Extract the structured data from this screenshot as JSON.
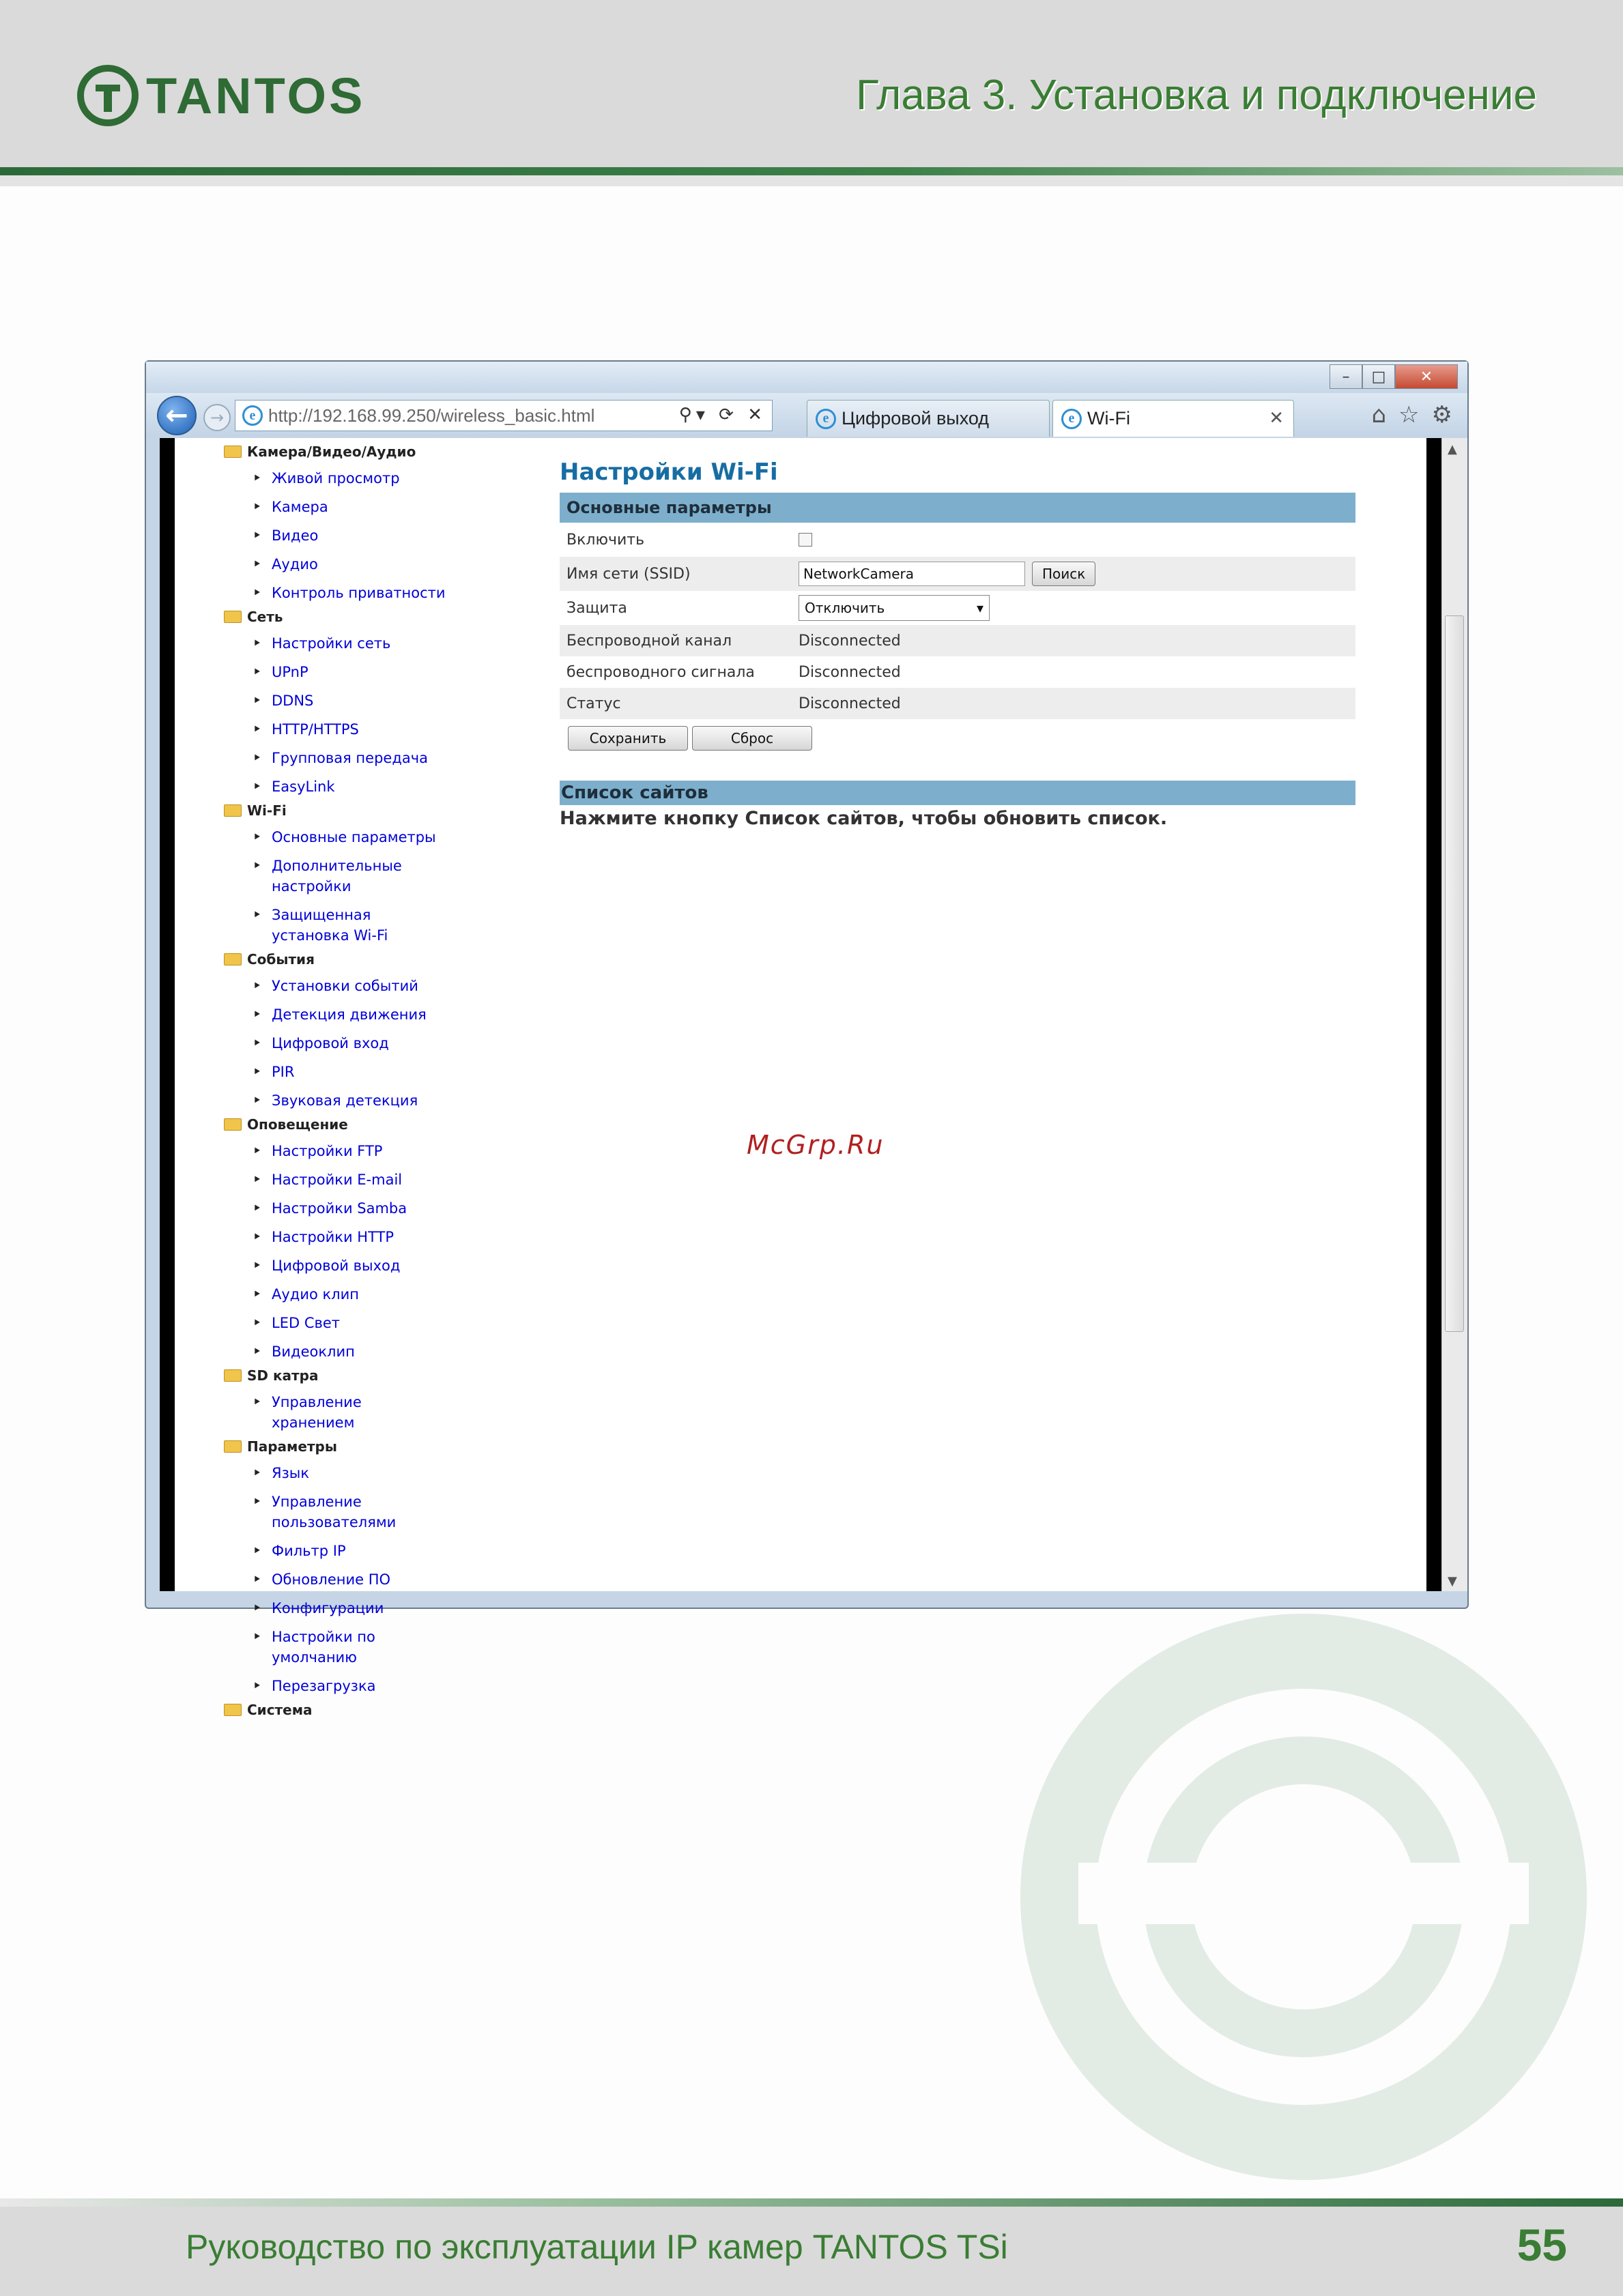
{
  "header": {
    "logo_text": "TANTOS",
    "chapter": "Глава 3. Установка и подключение"
  },
  "footer": {
    "title": "Руководство по эксплуатации IP камер TANTOS TSi",
    "page_number": "55"
  },
  "browser": {
    "url": "http://192.168.99.250/wireless_basic.html",
    "tabs": [
      {
        "label": "Цифровой выход"
      },
      {
        "label": "Wi-Fi"
      }
    ],
    "window_controls": {
      "minimize": "–",
      "maximize": "□",
      "close": "✕"
    }
  },
  "sidebar": [
    {
      "label": "Камера/Видео/Аудио",
      "items": [
        "Живой просмотр",
        "Камера",
        "Видео",
        "Аудио",
        "Контроль приватности"
      ]
    },
    {
      "label": "Сеть",
      "items": [
        "Настройки сеть",
        "UPnP",
        "DDNS",
        "HTTP/HTTPS",
        "Групповая передача",
        "EasyLink"
      ]
    },
    {
      "label": "Wi-Fi",
      "items": [
        "Основные параметры",
        "Дополнительные\nнастройки",
        "Защищенная\nустановка Wi-Fi"
      ]
    },
    {
      "label": "События",
      "items": [
        "Установки событий",
        "Детекция движения",
        "Цифровой вход",
        "PIR",
        "Звуковая детекция"
      ]
    },
    {
      "label": "Оповещение",
      "items": [
        "Настройки FTP",
        "Настройки E-mail",
        "Настройки Samba",
        "Настройки HTTP",
        "Цифровой выход",
        "Аудио клип",
        "LED Свет",
        "Видеоклип"
      ]
    },
    {
      "label": "SD катра",
      "items": [
        "Управление\nхранением"
      ]
    },
    {
      "label": "Параметры",
      "items": [
        "Язык",
        "Управление\nпользователями",
        "Фильтр IP",
        "Обновление ПО",
        "Конфигурации",
        "Настройки по\nумолчанию",
        "Перезагрузка"
      ]
    },
    {
      "label": "Система",
      "items": []
    }
  ],
  "main": {
    "title": "Настройки Wi-Fi",
    "section_basic": "Основные параметры",
    "enable_label": "Включить",
    "enable_checked": false,
    "ssid_label": "Имя сети (SSID)",
    "ssid_value": "NetworkCamera",
    "search_button": "Поиск",
    "security_label": "Защита",
    "security_value": "Отключить",
    "channel_label": "Беспроводной канал",
    "channel_value": "Disconnected",
    "signal_label": "беспроводного сигнала",
    "signal_value": "Disconnected",
    "status_label": "Статус",
    "status_value": "Disconnected",
    "save_button": "Сохранить",
    "reset_button": "Сброс",
    "site_list_title": "Список сайтов",
    "site_list_text": "Нажмите кнопку Список сайтов, чтобы обновить список."
  },
  "watermark_text": "McGrp.Ru",
  "colors": {
    "brand_green": "#3a7d34",
    "section_bar": "#7dafcc",
    "link_blue": "#0000d8",
    "title_blue": "#176da3"
  }
}
